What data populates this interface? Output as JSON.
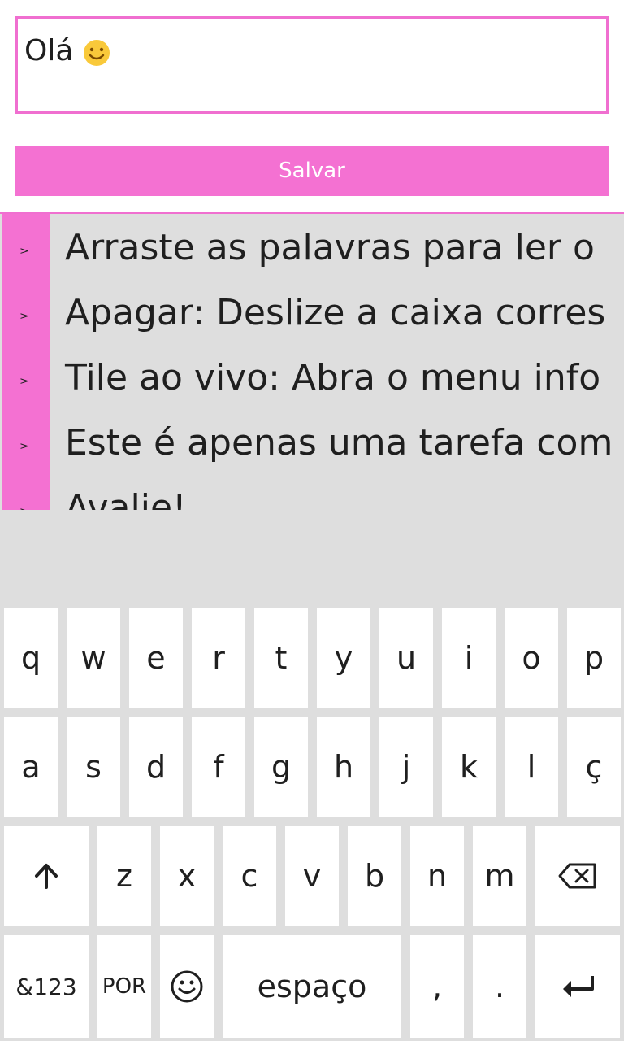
{
  "note_input": {
    "value": "Olá",
    "emoji": "smiley"
  },
  "save_button": {
    "label": "Salvar"
  },
  "tips": [
    {
      "text": "Arraste as palavras para ler o",
      "chevron": ">"
    },
    {
      "text": "Apagar: Deslize a caixa corres",
      "chevron": ">"
    },
    {
      "text": "Tile ao vivo: Abra o menu info",
      "chevron": ">"
    },
    {
      "text": "Este é apenas uma tarefa com",
      "chevron": ">"
    },
    {
      "text": "Avalie!",
      "chevron": ">"
    }
  ],
  "colors": {
    "accent": "#f471d2",
    "list_bg": "#dedede",
    "keyboard_bg": "#dedede"
  },
  "keyboard": {
    "row1": [
      "q",
      "w",
      "e",
      "r",
      "t",
      "y",
      "u",
      "i",
      "o",
      "p"
    ],
    "row2": [
      "a",
      "s",
      "d",
      "f",
      "g",
      "h",
      "j",
      "k",
      "l",
      "ç"
    ],
    "row3": [
      "z",
      "x",
      "c",
      "v",
      "b",
      "n",
      "m"
    ],
    "numbers_label": "&123",
    "language_label": "POR",
    "space_label": "espaço",
    "comma_label": ",",
    "period_label": "."
  }
}
